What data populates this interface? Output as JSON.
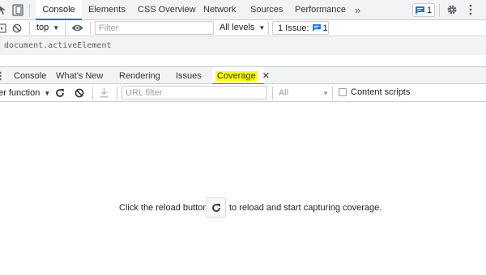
{
  "top_tabs": [
    "Console",
    "Elements",
    "CSS Overview",
    "Network",
    "Sources",
    "Performance"
  ],
  "top_tabs_active": "Console",
  "more_tabs_glyph": "»",
  "issues_badge_count": "1",
  "console_toolbar": {
    "context": "top",
    "filter_placeholder": "Filter",
    "levels": "All levels",
    "issues_label": "1 Issue:",
    "issues_count": "1"
  },
  "console_expression": "document.activeElement",
  "drawer_tabs": [
    "Console",
    "What's New",
    "Rendering",
    "Issues",
    "Coverage"
  ],
  "drawer_active": "Coverage",
  "coverage_toolbar": {
    "mode": "er function",
    "url_filter_placeholder": "URL filter",
    "type_select": "All",
    "content_scripts_label": "Content scripts",
    "content_scripts_checked": false
  },
  "empty_state": {
    "before": "Click the reload button",
    "after": "to reload and start capturing coverage."
  },
  "colors": {
    "accent": "#1a73e8",
    "highlight": "#ffff00",
    "toolbar_bg": "#f1f3f4"
  }
}
